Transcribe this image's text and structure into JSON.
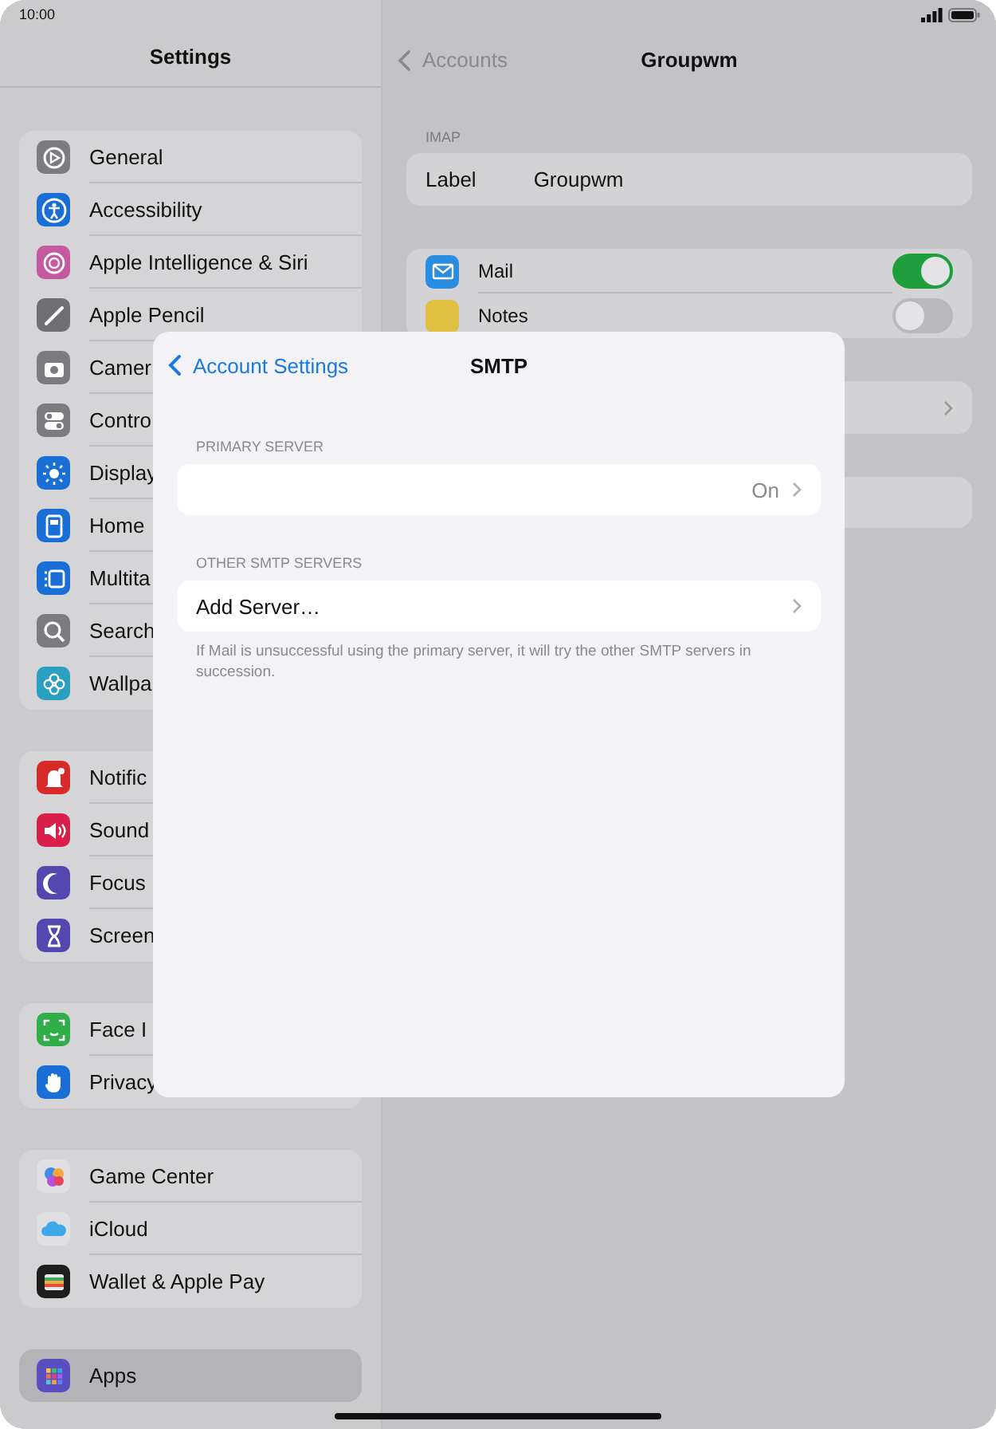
{
  "status_bar": {
    "time": "10:00"
  },
  "sidebar": {
    "title": "Settings",
    "groups": [
      {
        "items": [
          {
            "label": "General",
            "color": "#7c7c80",
            "selected": false
          },
          {
            "label": "Accessibility",
            "color": "#1a6fd6",
            "selected": false
          },
          {
            "label": "Apple Intelligence & Siri",
            "color": "#c65aa0",
            "selected": false
          },
          {
            "label": "Apple Pencil",
            "color": "#707074",
            "selected": false
          },
          {
            "label": "Camer",
            "color": "#7c7c80",
            "selected": false
          },
          {
            "label": "Contro",
            "color": "#7c7c80",
            "selected": false
          },
          {
            "label": "Display",
            "color": "#1a6fd6",
            "selected": false
          },
          {
            "label": "Home",
            "color": "#1a6fd6",
            "selected": false
          },
          {
            "label": "Multita",
            "color": "#1a6fd6",
            "selected": false
          },
          {
            "label": "Search",
            "color": "#7c7c80",
            "selected": false
          },
          {
            "label": "Wallpa",
            "color": "#2aa0c0",
            "selected": false
          }
        ]
      },
      {
        "items": [
          {
            "label": "Notific",
            "color": "#d92a2a",
            "selected": false
          },
          {
            "label": "Sound",
            "color": "#d9204a",
            "selected": false
          },
          {
            "label": "Focus",
            "color": "#5448b0",
            "selected": false
          },
          {
            "label": "Screen",
            "color": "#5448b0",
            "selected": false
          }
        ]
      },
      {
        "items": [
          {
            "label": "Face I",
            "color": "#2fae4a",
            "selected": false
          },
          {
            "label": "Privacy",
            "color": "#1a6fd6",
            "selected": false
          }
        ]
      },
      {
        "items": [
          {
            "label": "Game Center",
            "color": "#e0e0e2",
            "selected": false
          },
          {
            "label": "iCloud",
            "color": "#e0e0e2",
            "selected": false
          },
          {
            "label": "Wallet & Apple Pay",
            "color": "#1e1e1e",
            "selected": false
          }
        ]
      },
      {
        "items": [
          {
            "label": "Apps",
            "color": "#5a4ec0",
            "selected": true
          }
        ]
      }
    ]
  },
  "detail": {
    "back": "Accounts",
    "title": "Groupwm",
    "section_header": "IMAP",
    "label_row": {
      "label": "Label",
      "value": "Groupwm"
    },
    "toggles": [
      {
        "label": "Mail",
        "color": "#2a8ee0",
        "on": true
      },
      {
        "label": "Notes",
        "color": "#e0c040",
        "on": false
      }
    ]
  },
  "sheet": {
    "back": "Account Settings",
    "title": "SMTP",
    "sections": [
      {
        "header": "PRIMARY SERVER",
        "rows": [
          {
            "value": "On"
          }
        ]
      },
      {
        "header": "OTHER SMTP SERVERS",
        "rows": [
          {
            "label": "Add Server…"
          }
        ],
        "footer": "If Mail is unsuccessful using the primary server, it will try the other SMTP servers in succession."
      }
    ]
  }
}
